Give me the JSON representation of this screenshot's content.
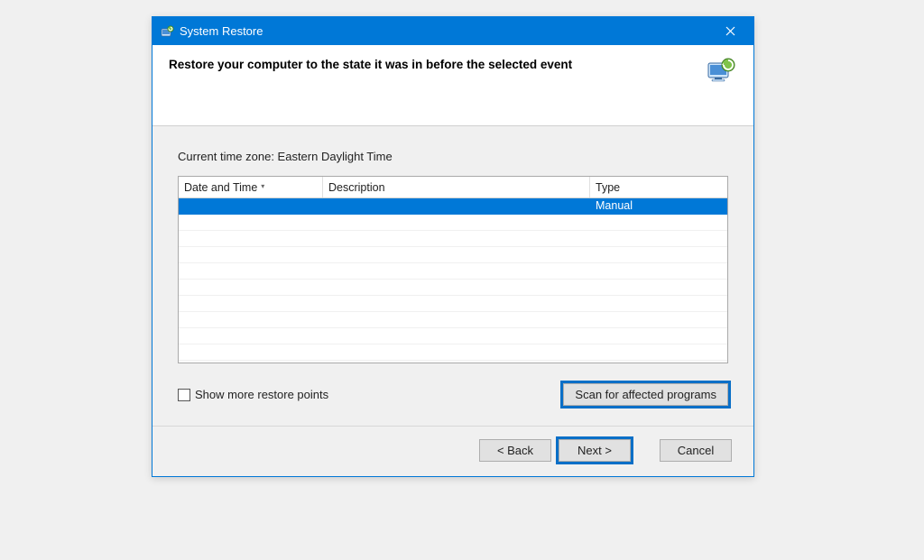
{
  "titlebar": {
    "title": "System Restore"
  },
  "header": {
    "heading": "Restore your computer to the state it was in before the selected event"
  },
  "content": {
    "timezone_label": "Current time zone: Eastern Daylight Time",
    "columns": {
      "datetime": "Date and Time",
      "description": "Description",
      "type": "Type"
    },
    "rows": [
      {
        "datetime": "",
        "description": "",
        "type": "Manual",
        "selected": true
      }
    ],
    "show_more_label": "Show more restore points",
    "scan_label": "Scan for affected programs"
  },
  "footer": {
    "back": "< Back",
    "next": "Next >",
    "cancel": "Cancel"
  }
}
